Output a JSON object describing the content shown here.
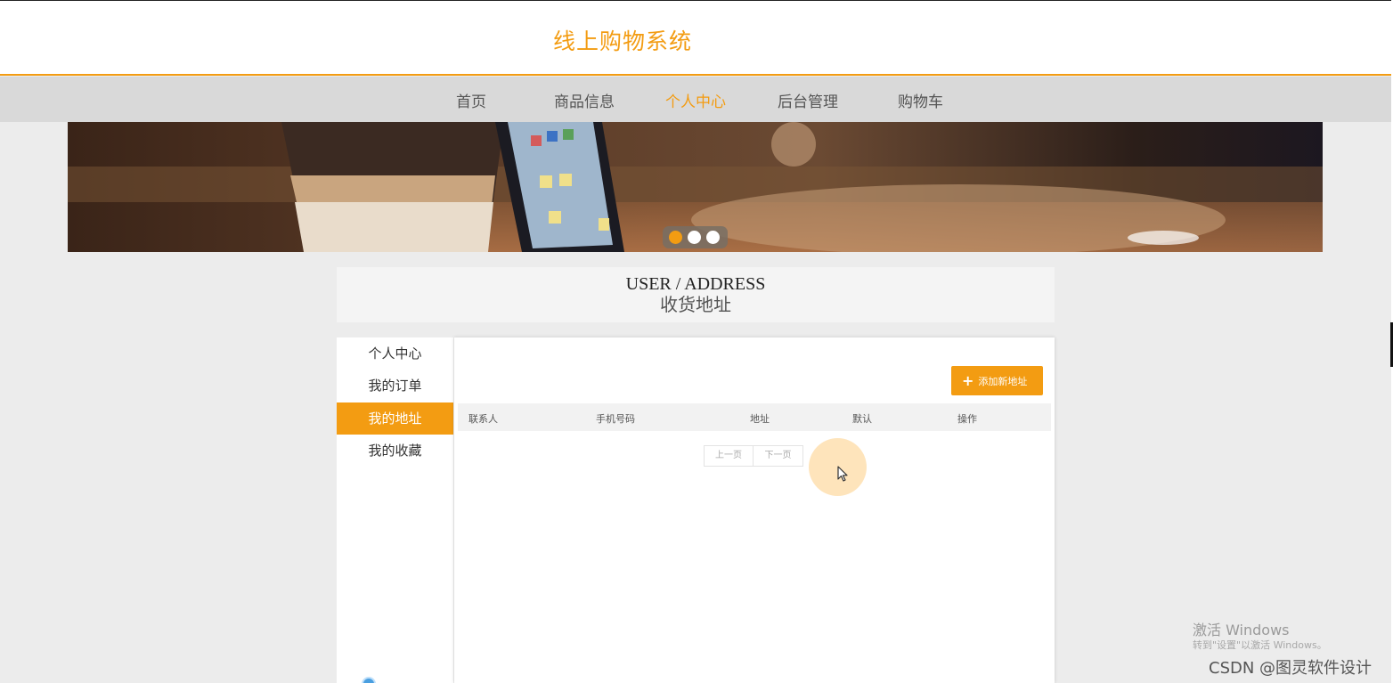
{
  "header": {
    "site_title": "线上购物系统"
  },
  "nav": {
    "items": [
      {
        "label": "首页"
      },
      {
        "label": "商品信息"
      },
      {
        "label": "个人中心",
        "active": true
      },
      {
        "label": "后台管理"
      },
      {
        "label": "购物车"
      }
    ]
  },
  "banner": {
    "slide_count": 3,
    "active_slide": 1
  },
  "section": {
    "title_en": "USER / ADDRESS",
    "title_cn": "收货地址"
  },
  "sidebar": {
    "items": [
      {
        "label": "个人中心"
      },
      {
        "label": "我的订单"
      },
      {
        "label": "我的地址",
        "active": true
      },
      {
        "label": "我的收藏"
      }
    ]
  },
  "content": {
    "add_button_label": "添加新地址",
    "table_headers": [
      "联系人",
      "手机号码",
      "地址",
      "默认",
      "操作"
    ],
    "rows": [],
    "pager": {
      "prev_label": "上一页",
      "next_label": "下一页"
    }
  },
  "watermark": {
    "line1": "激活 Windows",
    "line2": "转到\"设置\"以激活 Windows。",
    "line3": "CSDN @图灵软件设计"
  },
  "colors": {
    "accent": "#f39c12",
    "nav_bg": "#d9d9d9",
    "page_bg": "#ececec"
  }
}
